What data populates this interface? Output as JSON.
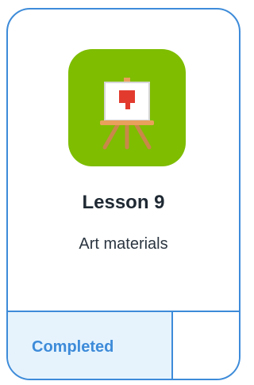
{
  "lesson": {
    "icon": "easel-painting-icon",
    "title": "Lesson 9",
    "subtitle": "Art materials",
    "status": "Completed"
  },
  "colors": {
    "card_border": "#3d8bd9",
    "icon_background": "#7ebd00",
    "status_background": "#e6f3fd",
    "status_text": "#3d8bd9",
    "paint_red": "#e23b2e",
    "easel_wood": "#c9874a"
  }
}
